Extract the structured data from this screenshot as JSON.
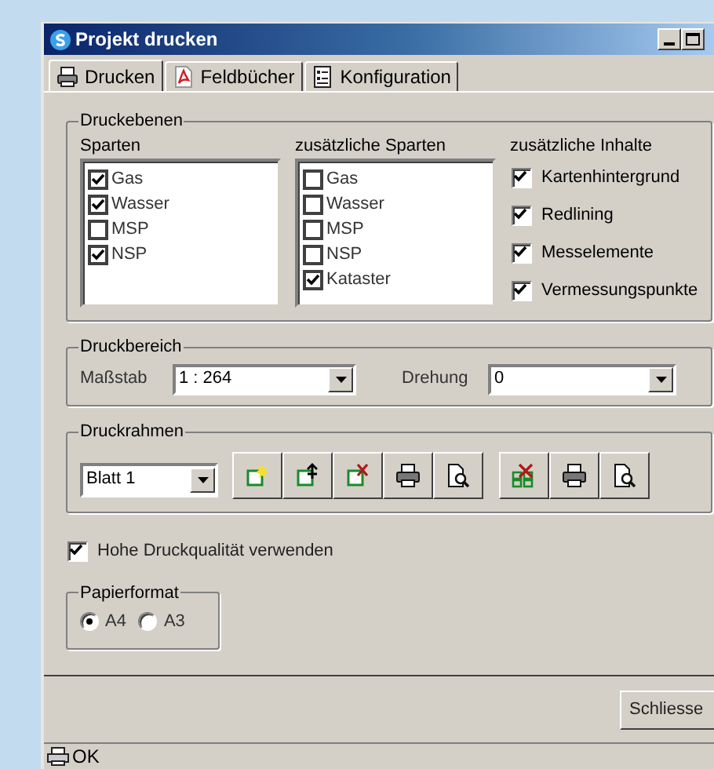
{
  "window": {
    "title": "Projekt drucken"
  },
  "tabs": [
    {
      "label": "Drucken",
      "selected": true
    },
    {
      "label": "Feldbücher",
      "selected": false
    },
    {
      "label": "Konfiguration",
      "selected": false
    }
  ],
  "druckebenen": {
    "title": "Druckebenen",
    "columns": [
      {
        "label": "Sparten",
        "kind": "list",
        "items": [
          {
            "label": "Gas",
            "checked": true
          },
          {
            "label": "Wasser",
            "checked": true
          },
          {
            "label": "MSP",
            "checked": false
          },
          {
            "label": "NSP",
            "checked": true
          }
        ]
      },
      {
        "label": "zusätzliche Sparten",
        "kind": "list",
        "items": [
          {
            "label": "Gas",
            "checked": false
          },
          {
            "label": "Wasser",
            "checked": false
          },
          {
            "label": "MSP",
            "checked": false
          },
          {
            "label": "NSP",
            "checked": false
          },
          {
            "label": "Kataster",
            "checked": true
          }
        ]
      },
      {
        "label": "zusätzliche Inhalte",
        "kind": "plain",
        "items": [
          {
            "label": "Kartenhintergrund",
            "checked": true
          },
          {
            "label": "Redlining",
            "checked": true
          },
          {
            "label": "Messelemente",
            "checked": true
          },
          {
            "label": "Vermessungspunkte",
            "checked": true
          }
        ]
      }
    ]
  },
  "druckbereich": {
    "title": "Druckbereich",
    "massstab": {
      "label": "Maßstab",
      "value": "1 : 264"
    },
    "drehung": {
      "label": "Drehung",
      "value": "0"
    }
  },
  "druckrahmen": {
    "title": "Druckrahmen",
    "blatt": {
      "value": "Blatt 1"
    }
  },
  "high_quality": {
    "label": "Hohe Druckqualität verwenden",
    "checked": true
  },
  "papierformat": {
    "title": "Papierformat",
    "options": [
      {
        "label": "A4",
        "selected": true
      },
      {
        "label": "A3",
        "selected": false
      }
    ]
  },
  "buttons": [
    "Schliesse"
  ],
  "status_bar": {
    "text": "OK"
  }
}
